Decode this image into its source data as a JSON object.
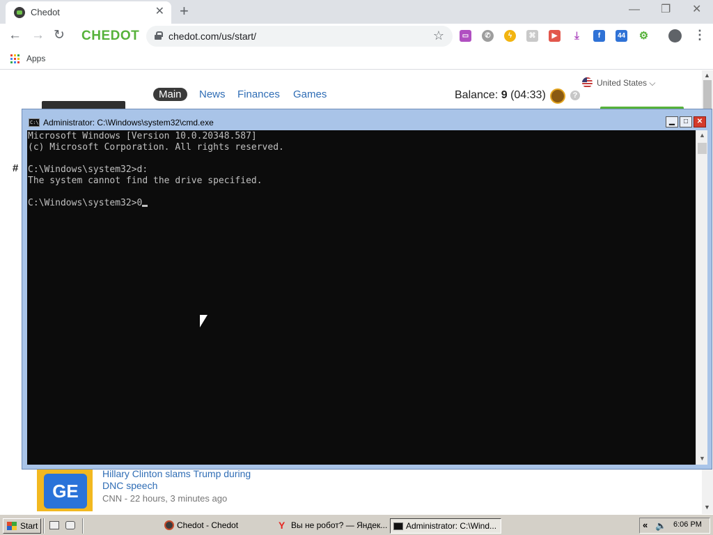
{
  "browser": {
    "tab_title": "Chedot",
    "brand": "CHEDOT",
    "url": "chedot.com/us/start/",
    "bookmarks": {
      "apps_label": "Apps"
    }
  },
  "page": {
    "region": "United States",
    "nav": [
      "Main",
      "News",
      "Finances",
      "Games"
    ],
    "balance_label": "Balance:",
    "balance_value": "9",
    "balance_timer": "(04:33)",
    "hash": "#",
    "news": {
      "headline": "Hillary Clinton slams Trump during DNC speech",
      "source": "CNN - 22 hours, 3 minutes ago",
      "thumb_text": "GE"
    }
  },
  "cmd": {
    "title": "Administrator: C:\\Windows\\system32\\cmd.exe",
    "icon_text": "C:\\",
    "lines": [
      "Microsoft Windows [Version 10.0.20348.587]",
      "(c) Microsoft Corporation. All rights reserved.",
      "",
      "C:\\Windows\\system32>d:",
      "The system cannot find the drive specified.",
      "",
      "C:\\Windows\\system32>0"
    ]
  },
  "taskbar": {
    "start_label": "Start",
    "tasks": [
      {
        "label": "Chedot - Chedot",
        "active": false
      },
      {
        "label": "Вы не робот? — Яндек...",
        "active": false
      },
      {
        "label": "Administrator: C:\\Wind...",
        "active": true
      }
    ],
    "clock": "6:06 PM"
  },
  "icons": {
    "back": "arrow-left",
    "forward": "arrow-right",
    "reload": "reload",
    "star": "star",
    "profile": "account-circle",
    "menu": "more-vert"
  },
  "colors": {
    "brand_green": "#56b23a",
    "link_blue": "#2f6db5",
    "console_bg": "#0c0c0c",
    "console_text": "#c0c0c0",
    "titlebar": "#a9c4e8"
  }
}
